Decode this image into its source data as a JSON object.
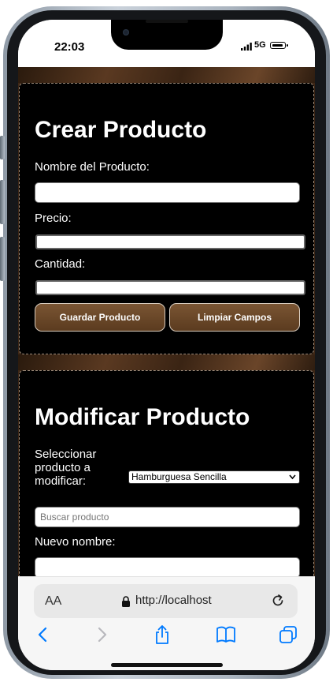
{
  "status": {
    "time": "22:03",
    "network": "5G"
  },
  "crear": {
    "title": "Crear Producto",
    "name_label": "Nombre del Producto:",
    "name_value": "",
    "price_label": "Precio:",
    "price_value": "",
    "qty_label": "Cantidad:",
    "qty_value": "",
    "save_button": "Guardar Producto",
    "clear_button": "Limpiar Campos"
  },
  "modificar": {
    "title": "Modificar Producto",
    "select_label": "Seleccionar producto a modificar:",
    "selected_product": "Hamburguesa Sencilla",
    "search_placeholder": "Buscar producto",
    "new_name_label": "Nuevo nombre:",
    "new_name_value": ""
  },
  "browser": {
    "text_size_label": "AA",
    "url": "http://localhost",
    "toolbar_icons": [
      "back-icon",
      "forward-icon",
      "share-icon",
      "bookmarks-icon",
      "tabs-icon"
    ]
  },
  "colors": {
    "button_brown": "#6a4528",
    "band_brown": "#4a2f1a",
    "card_bg": "#000000",
    "ios_blue": "#007aff"
  }
}
